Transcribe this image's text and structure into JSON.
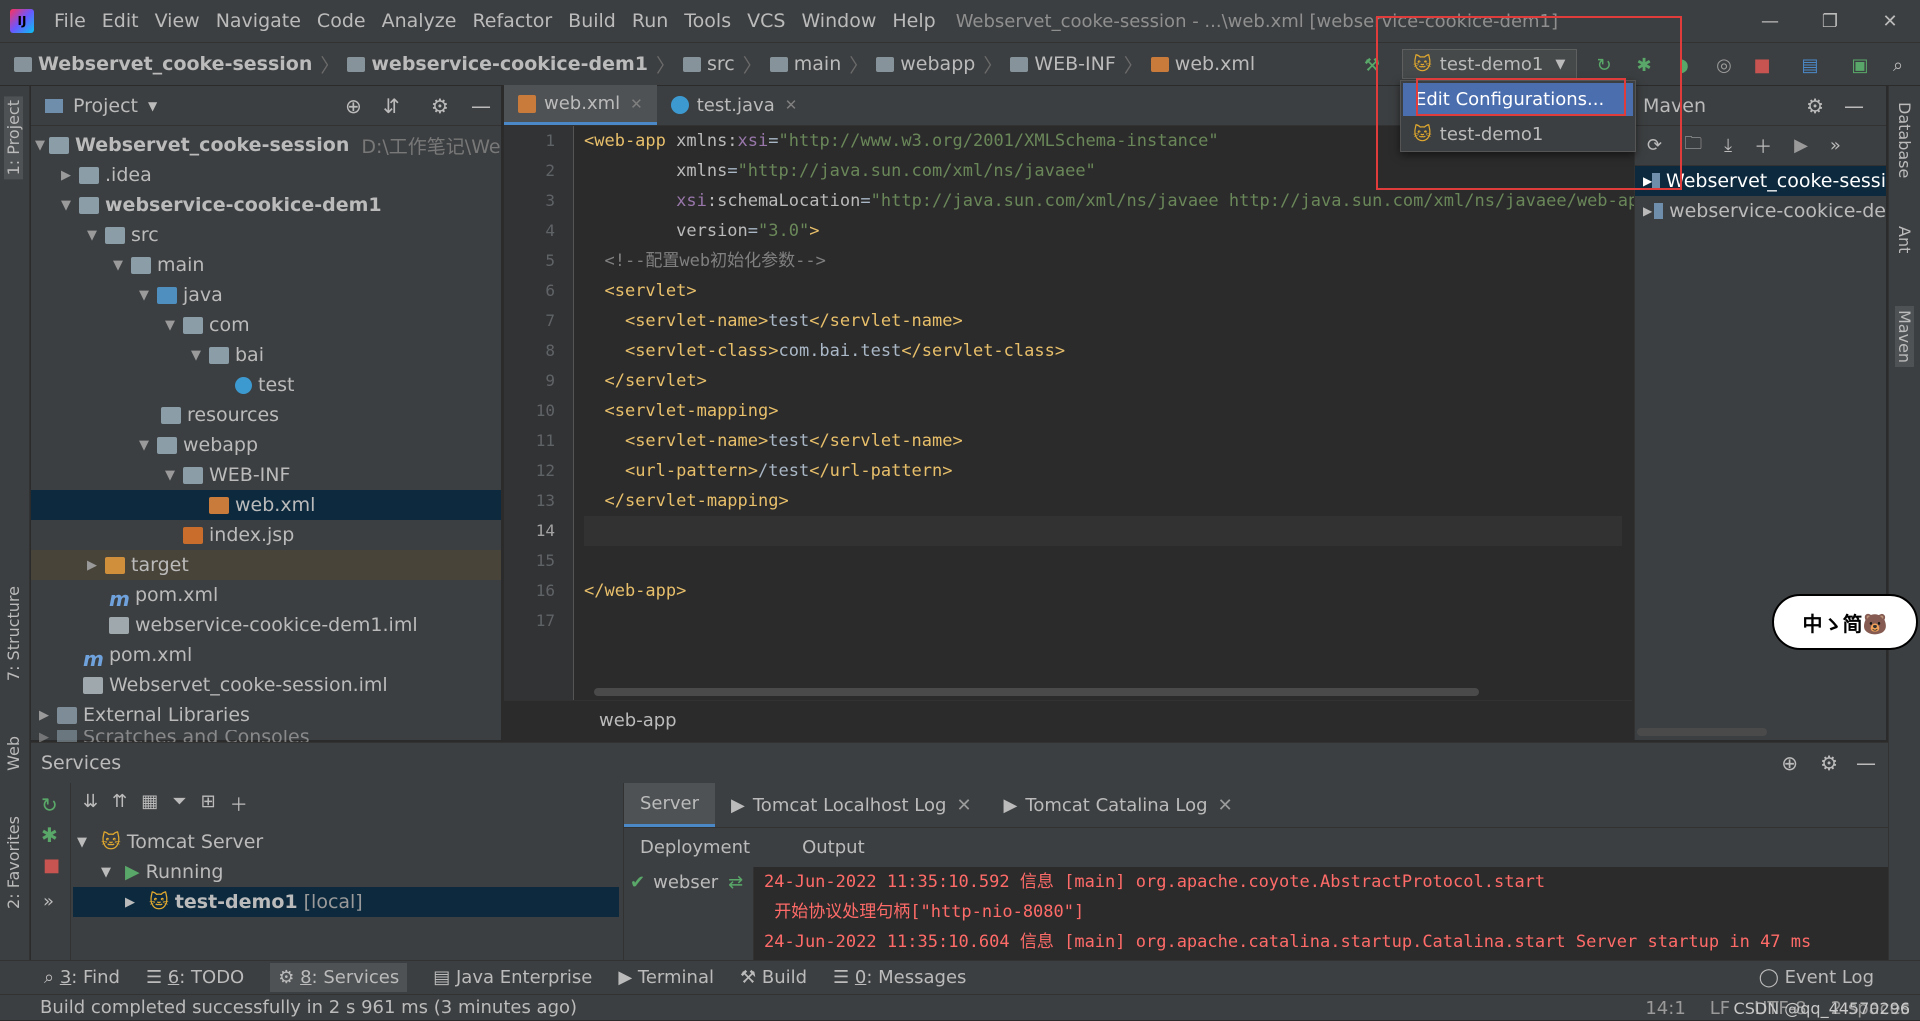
{
  "app": {
    "menus": [
      "File",
      "Edit",
      "View",
      "Navigate",
      "Code",
      "Analyze",
      "Refactor",
      "Build",
      "Run",
      "Tools",
      "VCS",
      "Window",
      "Help"
    ],
    "title": "Webservet_cooke-session - ...\\web.xml [webservice-cookice-dem1]"
  },
  "breadcrumbs": [
    "Webservet_cooke-session",
    "webservice-cookice-dem1",
    "src",
    "main",
    "webapp",
    "WEB-INF",
    "web.xml"
  ],
  "run_config": {
    "selected": "test-demo1",
    "popup_items": [
      "Edit Configurations...",
      "test-demo1"
    ]
  },
  "left_strip": {
    "project": "1: Project",
    "structure": "7: Structure",
    "web": "Web",
    "favorites": "2: Favorites"
  },
  "right_strip": {
    "database": "Database",
    "ant": "Ant",
    "maven": "Maven"
  },
  "project": {
    "header": "Project",
    "tree": [
      {
        "label": "Webservet_cooke-session",
        "hint": "D:\\工作笔记\\Webser"
      },
      {
        "label": ".idea"
      },
      {
        "label": "webservice-cookice-dem1"
      },
      {
        "label": "src"
      },
      {
        "label": "main"
      },
      {
        "label": "java"
      },
      {
        "label": "com"
      },
      {
        "label": "bai"
      },
      {
        "label": "test"
      },
      {
        "label": "resources"
      },
      {
        "label": "webapp"
      },
      {
        "label": "WEB-INF"
      },
      {
        "label": "web.xml"
      },
      {
        "label": "index.jsp"
      },
      {
        "label": "target"
      },
      {
        "label": "pom.xml"
      },
      {
        "label": "webservice-cookice-dem1.iml"
      },
      {
        "label": "pom.xml"
      },
      {
        "label": "Webservet_cooke-session.iml"
      },
      {
        "label": "External Libraries"
      },
      {
        "label": "Scratches and Consoles"
      }
    ]
  },
  "editor": {
    "tabs": [
      "web.xml",
      "test.java"
    ],
    "line_numbers": [
      "1",
      "2",
      "3",
      "4",
      "5",
      "6",
      "7",
      "8",
      "9",
      "10",
      "11",
      "12",
      "13",
      "14",
      "15",
      "16",
      "17"
    ],
    "breadcrumb": "web-app",
    "code": {
      "l1a": "<web-app ",
      "l1b": "xmlns:",
      "l1c": "xsi",
      "l1d": "=",
      "l1e": "\"http://www.w3.org/2001/XMLSchema-instance\"",
      "l2a": "xmlns",
      "l2b": "=",
      "l2c": "\"http://java.sun.com/xml/ns/javaee\"",
      "l3a": "xsi",
      "l3b": ":schemaLocation",
      "l3c": "=",
      "l3d": "\"http://java.sun.com/xml/ns/javaee http://java.sun.com/xml/ns/javaee/web-app",
      "l4a": "version",
      "l4b": "=",
      "l4c": "\"3.0\"",
      "l4d": ">",
      "l5": "<!--配置web初始化参数-->",
      "l6": "<servlet>",
      "l7a": "<servlet-name>",
      "l7b": "test",
      "l7c": "</servlet-name>",
      "l8a": "<servlet-class>",
      "l8b": "com.bai.test",
      "l8c": "</servlet-class>",
      "l9": "</servlet>",
      "l10": "<servlet-mapping>",
      "l11a": "<servlet-name>",
      "l11b": "test",
      "l11c": "</servlet-name>",
      "l12a": "<url-pattern>",
      "l12b": "/test",
      "l12c": "</url-pattern>",
      "l13": "</servlet-mapping>",
      "l16": "</web-app>"
    }
  },
  "maven": {
    "header": "Maven",
    "items": [
      "Webservet_cooke-sessi",
      "webservice-cookice-de"
    ]
  },
  "services": {
    "header": "Services",
    "tree": {
      "server": "Tomcat Server",
      "running": "Running",
      "app": "test-demo1",
      "app_hint": "[local]"
    },
    "tabs": [
      "Server",
      "Tomcat Localhost Log",
      "Tomcat Catalina Log"
    ],
    "subtabs": [
      "Deployment",
      "Output"
    ],
    "deploy_item": "webser",
    "output": [
      "24-Jun-2022 11:35:10.592 信息 [main] org.apache.coyote.AbstractProtocol.start",
      " 开始协议处理句柄[\"http-nio-8080\"]",
      "24-Jun-2022 11:35:10.604 信息 [main] org.apache.catalina.startup.Catalina.start Server startup in 47 ms"
    ]
  },
  "toolwindows": [
    {
      "num": "3",
      "label": ": Find"
    },
    {
      "num": "6",
      "label": ": TODO"
    },
    {
      "num": "8",
      "label": ": Services"
    },
    {
      "num": "",
      "label": "Java Enterprise"
    },
    {
      "num": "",
      "label": "Terminal"
    },
    {
      "num": "",
      "label": "Build"
    },
    {
      "num": "0",
      "label": ": Messages"
    }
  ],
  "event_log": "Event Log",
  "status": {
    "message": "Build completed successfully in 2 s 961 ms (3 minutes ago)",
    "position": "14:1",
    "line_sep": "LF",
    "encoding": "UTF-8",
    "indent": "2 spaces",
    "watermark": "CSDN @qq_44570296"
  },
  "float_badge": "中ゝ简🐻",
  "colors": {
    "accent": "#4a88c7",
    "selection": "#0d293e",
    "highlight_box": "#e03c3c",
    "error_text": "#ff6b68"
  }
}
